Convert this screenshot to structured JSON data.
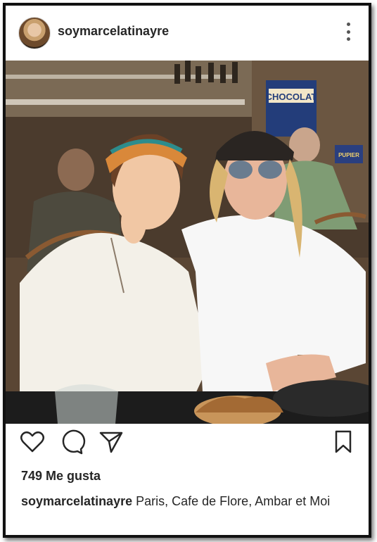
{
  "post": {
    "username": "soymarcelatinayre",
    "photo_alt": "",
    "sign_chocolat": "CHOCOLAT",
    "sign_pupier": "PUPIER",
    "likes": "749 Me gusta",
    "caption_user": "soymarcelatinayre",
    "caption_text": "Paris, Cafe de Flore, Ambar et Moi"
  },
  "icons": [
    "avatar",
    "more-options-icon",
    "heart-icon",
    "comment-icon",
    "share-icon",
    "bookmark-icon"
  ],
  "colors": {
    "text": "#262626",
    "frame": "#111111",
    "background": "#ffffff"
  }
}
